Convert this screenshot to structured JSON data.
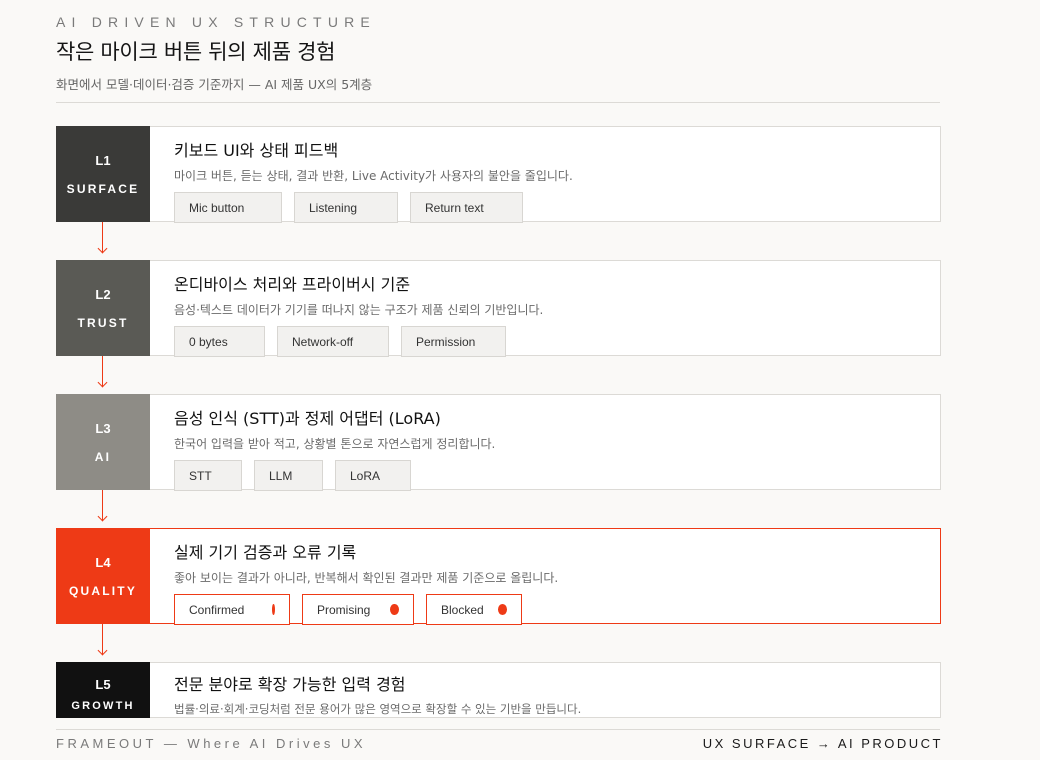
{
  "header": {
    "kicker": "AI DRIVEN UX STRUCTURE",
    "title": "작은 마이크 버튼 뒤의 제품 경험",
    "subtitle": "화면에서 모델·데이터·검증 기준까지 — AI 제품 UX의 5계층"
  },
  "colors": {
    "accent": "#ee3a16",
    "l1": "#3a3a38",
    "l2": "#5a5a55",
    "l3": "#8e8c86",
    "l4": "#ee3a16",
    "l5": "#111111"
  },
  "layers": [
    {
      "level": "L1",
      "tag": "SURFACE",
      "title": "키보드 UI와 상태 피드백",
      "desc": "마이크 버튼, 듣는 상태, 결과 반환, Live Activity가 사용자의 불안을 줄입니다.",
      "chips": [
        "Mic button",
        "Listening",
        "Return text"
      ]
    },
    {
      "level": "L2",
      "tag": "TRUST",
      "title": "온디바이스 처리와 프라이버시 기준",
      "desc": "음성·텍스트 데이터가 기기를 떠나지 않는 구조가 제품 신뢰의 기반입니다.",
      "chips": [
        "0 bytes",
        "Network-off",
        "Permission"
      ]
    },
    {
      "level": "L3",
      "tag": "AI",
      "title": "음성 인식 (STT)과 정제 어댑터 (LoRA)",
      "desc": "한국어 입력을 받아 적고, 상황별 톤으로 자연스럽게 정리합니다.",
      "chips": [
        "STT",
        "LLM",
        "LoRA"
      ]
    },
    {
      "level": "L4",
      "tag": "QUALITY",
      "title": "실제 기기 검증과 오류 기록",
      "desc": "좋아 보이는 결과가 아니라, 반복해서 확인된 결과만 제품 기준으로 올립니다.",
      "chips": [
        "Confirmed",
        "Promising",
        "Blocked"
      ]
    },
    {
      "level": "L5",
      "tag": "GROWTH",
      "title": "전문 분야로 확장 가능한 입력 경험",
      "desc": "법률·의료·회계·코딩처럼 전문 용어가 많은 영역으로 확장할 수 있는 기반을 만듭니다."
    }
  ],
  "footer": {
    "left": "FRAMEOUT — Where AI Drives UX",
    "right": "UX SURFACE → AI PRODUCT"
  }
}
